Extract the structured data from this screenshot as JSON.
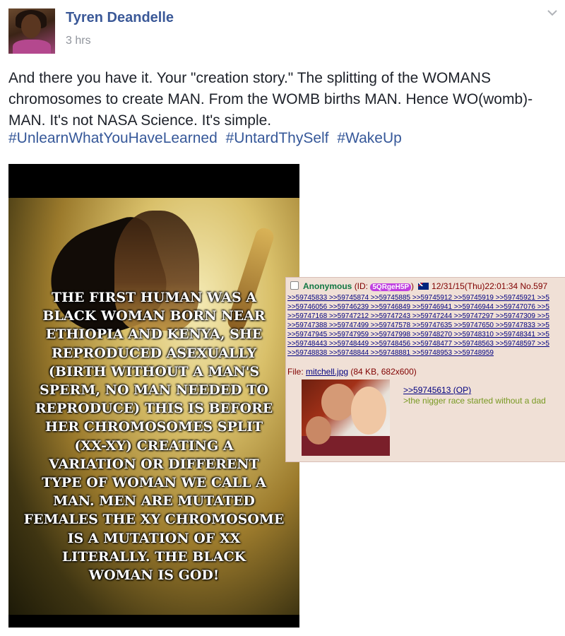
{
  "post": {
    "author": "Tyren Deandelle",
    "time": "3 hrs",
    "text": "And there you have it. Your \"creation story.\" The splitting of the WOMANS chromosomes to create MAN. From the WOMB births MAN. Hence WO(womb)-MAN. It's not NASA Science. It's simple.",
    "hashtags": [
      "#UnlearnWhatYouHaveLearned",
      "#UntardThySelf",
      "#WakeUp"
    ],
    "icons": {
      "avatar": "profile-photo",
      "options": "chevron-down-icon"
    }
  },
  "meme": {
    "lines": [
      "THE FIRST HUMAN WAS A",
      "BLACK WOMAN BORN NEAR",
      "ETHIOPIA AND KENYA, SHE",
      "REPRODUCED ASEXUALLY",
      "(BIRTH WITHOUT A MAN'S",
      "SPERM, NO MAN NEEDED TO",
      "REPRODUCE) THIS IS BEFORE",
      "HER CHROMOSOMES SPLIT",
      "(XX-XY) CREATING A",
      "VARIATION OR DIFFERENT",
      "TYPE OF WOMAN WE CALL A",
      "MAN.  MEN ARE MUTATED",
      "FEMALES THE XY CHROMOSOME",
      "IS A MUTATION OF XX",
      "LITERALLY.  THE BLACK",
      "WOMAN IS GOD!"
    ]
  },
  "chan": {
    "name": "Anonymous",
    "id_prefix": "(ID: ",
    "poster_id": "5QRgeH5P",
    "id_suffix": ")",
    "datetime": "12/31/15(Thu)22:01:34 No.597",
    "backlinks": [
      ">>59745833 >>59745874 >>59745885 >>59745912 >>59745919 >>59745921 >>5",
      ">>59746056 >>59746239 >>59746849 >>59746941 >>59746944 >>59747076 >>5",
      ">>59747168 >>59747212 >>59747243 >>59747244 >>59747297 >>59747309 >>5",
      ">>59747388 >>59747499 >>59747578 >>59747635 >>59747650 >>59747833 >>5",
      ">>59747945 >>59747959 >>59747998 >>59748270 >>59748310 >>59748341 >>5",
      ">>59748443 >>59748449 >>59748456 >>59748477 >>59748563 >>59748597 >>5",
      ">>59748838 >>59748844 >>59748881 >>59748953 >>59748959"
    ],
    "file_label": "File: ",
    "file_name": "mitchell.jpg",
    "file_info": " (84 KB, 682x600)",
    "quote_link": ">>59745613 (OP)",
    "greentext": ">the nigger race started without a dad"
  }
}
